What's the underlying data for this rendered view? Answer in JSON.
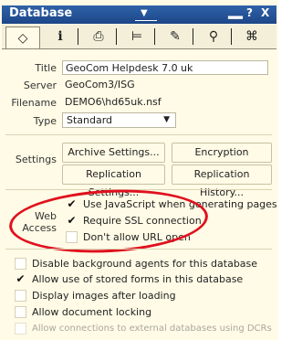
{
  "window": {
    "title": "Database",
    "buttons": [
      "▂▂",
      "?",
      "X"
    ]
  },
  "tabs": [
    {
      "icon": "info-tab-icon",
      "glyph": "🏷",
      "active": true
    },
    {
      "icon": "i-info-icon",
      "glyph": "i"
    },
    {
      "icon": "printer-icon",
      "glyph": "🖨"
    },
    {
      "icon": "design-icon",
      "glyph": "≑"
    },
    {
      "icon": "pen-icon",
      "glyph": "✒"
    },
    {
      "icon": "search-icon",
      "glyph": "🔍"
    },
    {
      "icon": "advanced-icon",
      "glyph": "⌘"
    }
  ],
  "info": {
    "title_label": "Title",
    "title_value": "GeoCom Helpdesk 7.0 uk",
    "server_label": "Server",
    "server_value": "GeoCom3/ISG",
    "filename_label": "Filename",
    "filename_value": "DEMO6\\hd65uk.nsf",
    "type_label": "Type",
    "type_value": "Standard"
  },
  "settings": {
    "label": "Settings",
    "archive": "Archive Settings...",
    "encryption": "Encryption Settings...",
    "replication": "Replication Settings...",
    "history": "Replication History..."
  },
  "web_access": {
    "label_line1": "Web",
    "label_line2": "Access",
    "options": [
      {
        "label": "Use JavaScript when generating pages",
        "checked": true
      },
      {
        "label": "Require SSL connection",
        "checked": true
      },
      {
        "label": "Don't allow URL open",
        "checked": false
      }
    ]
  },
  "options": [
    {
      "label": "Disable background agents for this database",
      "checked": false,
      "disabled": false
    },
    {
      "label": "Allow use of stored forms in this database",
      "checked": true,
      "disabled": false
    },
    {
      "label": "Display images after loading",
      "checked": false,
      "disabled": false
    },
    {
      "label": "Allow document locking",
      "checked": false,
      "disabled": false
    },
    {
      "label": "Allow connections to external databases using DCRs",
      "checked": false,
      "disabled": true
    }
  ],
  "annotation_color": "#e0101e"
}
